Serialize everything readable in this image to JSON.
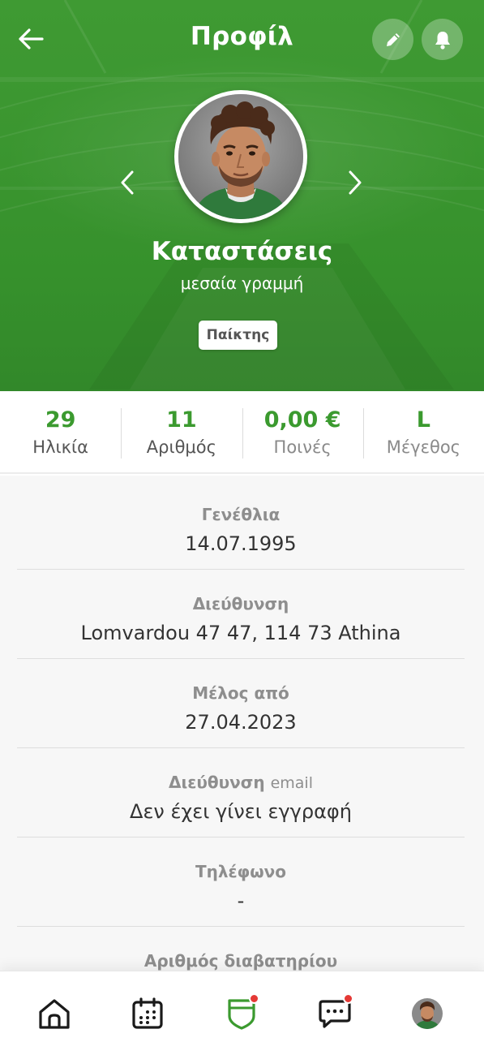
{
  "header": {
    "title": "Προφίλ",
    "back_icon": "arrow-left-icon",
    "edit_icon": "pencil-icon",
    "notifications_icon": "bell-icon"
  },
  "profile": {
    "name": "Καταστάσεις",
    "position": "μεσαία γραμμή",
    "role_badge": "Παίκτης"
  },
  "stats": [
    {
      "value": "29",
      "label": "Ηλικία"
    },
    {
      "value": "11",
      "label": "Αριθμός"
    },
    {
      "value": "0,00 €",
      "label": "Ποινές"
    },
    {
      "value": "L",
      "label": "Μέγεθος"
    }
  ],
  "details": [
    {
      "label": "Γενέθλια",
      "value": "14.07.1995"
    },
    {
      "label": "Διεύθυνση",
      "value": "Lomvardou 47 47, 114 73 Athina"
    },
    {
      "label": "Μέλος από",
      "value": "27.04.2023"
    },
    {
      "label": "Διεύθυνση",
      "label_suffix": "email",
      "value": "Δεν έχει γίνει εγγραφή"
    },
    {
      "label": "Τηλέφωνο",
      "value": "-"
    },
    {
      "label": "Αριθμός διαβατηρίου",
      "value": ""
    }
  ],
  "bottom_nav": [
    {
      "icon": "home-icon",
      "badge": false
    },
    {
      "icon": "calendar-icon",
      "badge": false
    },
    {
      "icon": "shield-icon",
      "badge": true,
      "active": true
    },
    {
      "icon": "chat-icon",
      "badge": true
    },
    {
      "icon": "profile-avatar",
      "badge": false
    }
  ],
  "colors": {
    "brand_green": "#3b9a2f",
    "hero_green": "#3a952f",
    "badge_red": "#e53935",
    "label_gray": "#8e8e8e",
    "value_dark": "#333333"
  }
}
